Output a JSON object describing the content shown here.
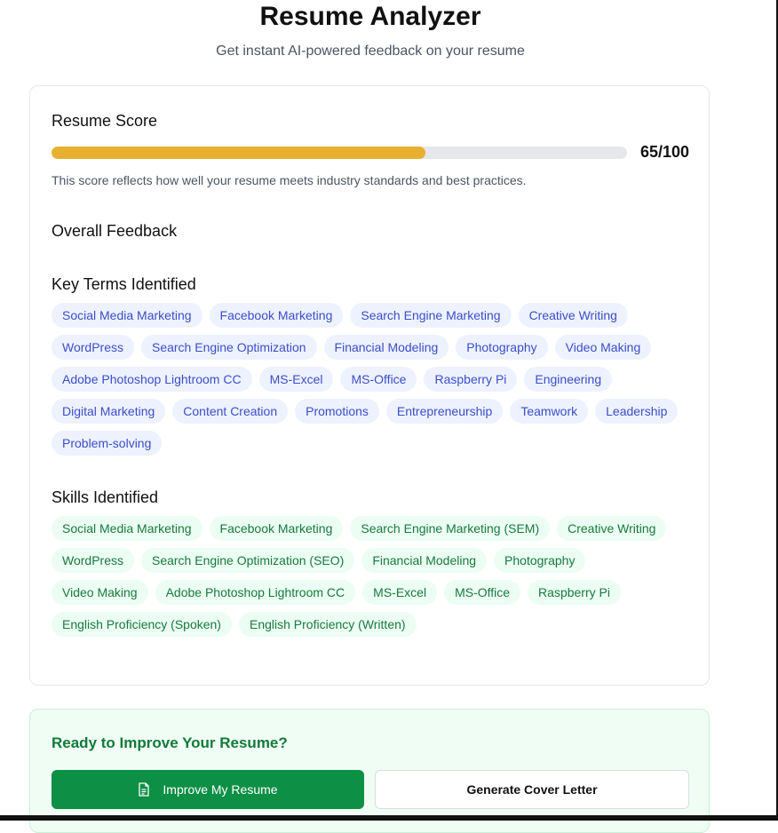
{
  "header": {
    "title": "Resume Analyzer",
    "subtitle": "Get instant AI-powered feedback on your resume"
  },
  "score_section": {
    "title": "Resume Score",
    "score": 65,
    "max": 100,
    "score_label": "65/100",
    "bar_color": "#e8b030",
    "description": "This score reflects how well your resume meets industry standards and best practices."
  },
  "feedback_section": {
    "title": "Overall Feedback"
  },
  "key_terms": {
    "title": "Key Terms Identified",
    "items": [
      "Social Media Marketing",
      "Facebook Marketing",
      "Search Engine Marketing",
      "Creative Writing",
      "WordPress",
      "Search Engine Optimization",
      "Financial Modeling",
      "Photography",
      "Video Making",
      "Adobe Photoshop Lightroom CC",
      "MS-Excel",
      "MS-Office",
      "Raspberry Pi",
      "Engineering",
      "Digital Marketing",
      "Content Creation",
      "Promotions",
      "Entrepreneurship",
      "Teamwork",
      "Leadership",
      "Problem-solving"
    ]
  },
  "skills": {
    "title": "Skills Identified",
    "items": [
      "Social Media Marketing",
      "Facebook Marketing",
      "Search Engine Marketing (SEM)",
      "Creative Writing",
      "WordPress",
      "Search Engine Optimization (SEO)",
      "Financial Modeling",
      "Photography",
      "Video Making",
      "Adobe Photoshop Lightroom CC",
      "MS-Excel",
      "MS-Office",
      "Raspberry Pi",
      "English Proficiency (Spoken)",
      "English Proficiency (Written)"
    ]
  },
  "cta": {
    "title": "Ready to Improve Your Resume?",
    "improve_label": "Improve My Resume",
    "improve_icon": "document-icon",
    "cover_letter_label": "Generate Cover Letter"
  },
  "colors": {
    "primary_green": "#0d8f45",
    "term_chip_text": "#3b4ec8",
    "skill_chip_text": "#177a3e"
  }
}
